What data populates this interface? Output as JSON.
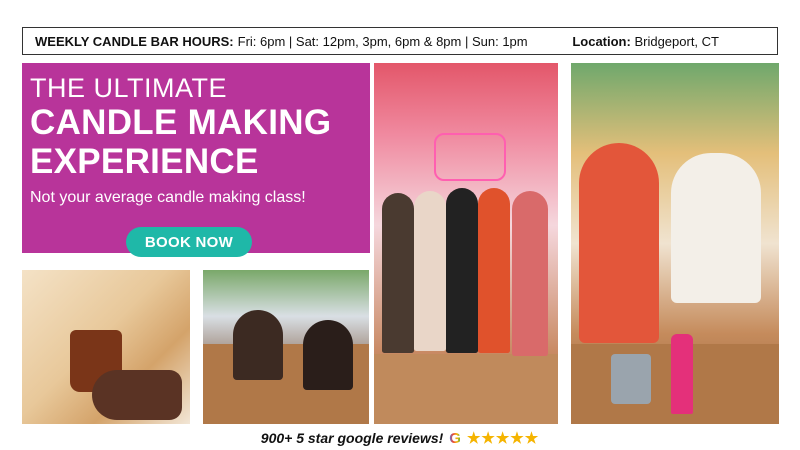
{
  "hours": {
    "label": "WEEKLY CANDLE BAR HOURS:",
    "schedule": "Fri: 6pm | Sat: 12pm, 3pm, 6pm & 8pm | Sun: 1pm",
    "location_label": "Location:",
    "location_value": "Bridgeport, CT"
  },
  "hero": {
    "line1": "THE ULTIMATE",
    "line2": "CANDLE MAKING",
    "line3": "EXPERIENCE",
    "subtitle": "Not your average candle making class!",
    "button_label": "BOOK NOW"
  },
  "reviews": {
    "text": "900+ 5 star google reviews!",
    "google_letter": "G",
    "stars": "★★★★★"
  },
  "colors": {
    "hero_bg": "#b8349a",
    "button_bg": "#1fb8a8",
    "star_color": "#f5b400"
  },
  "icons": [
    "google-icon",
    "star-icon"
  ]
}
